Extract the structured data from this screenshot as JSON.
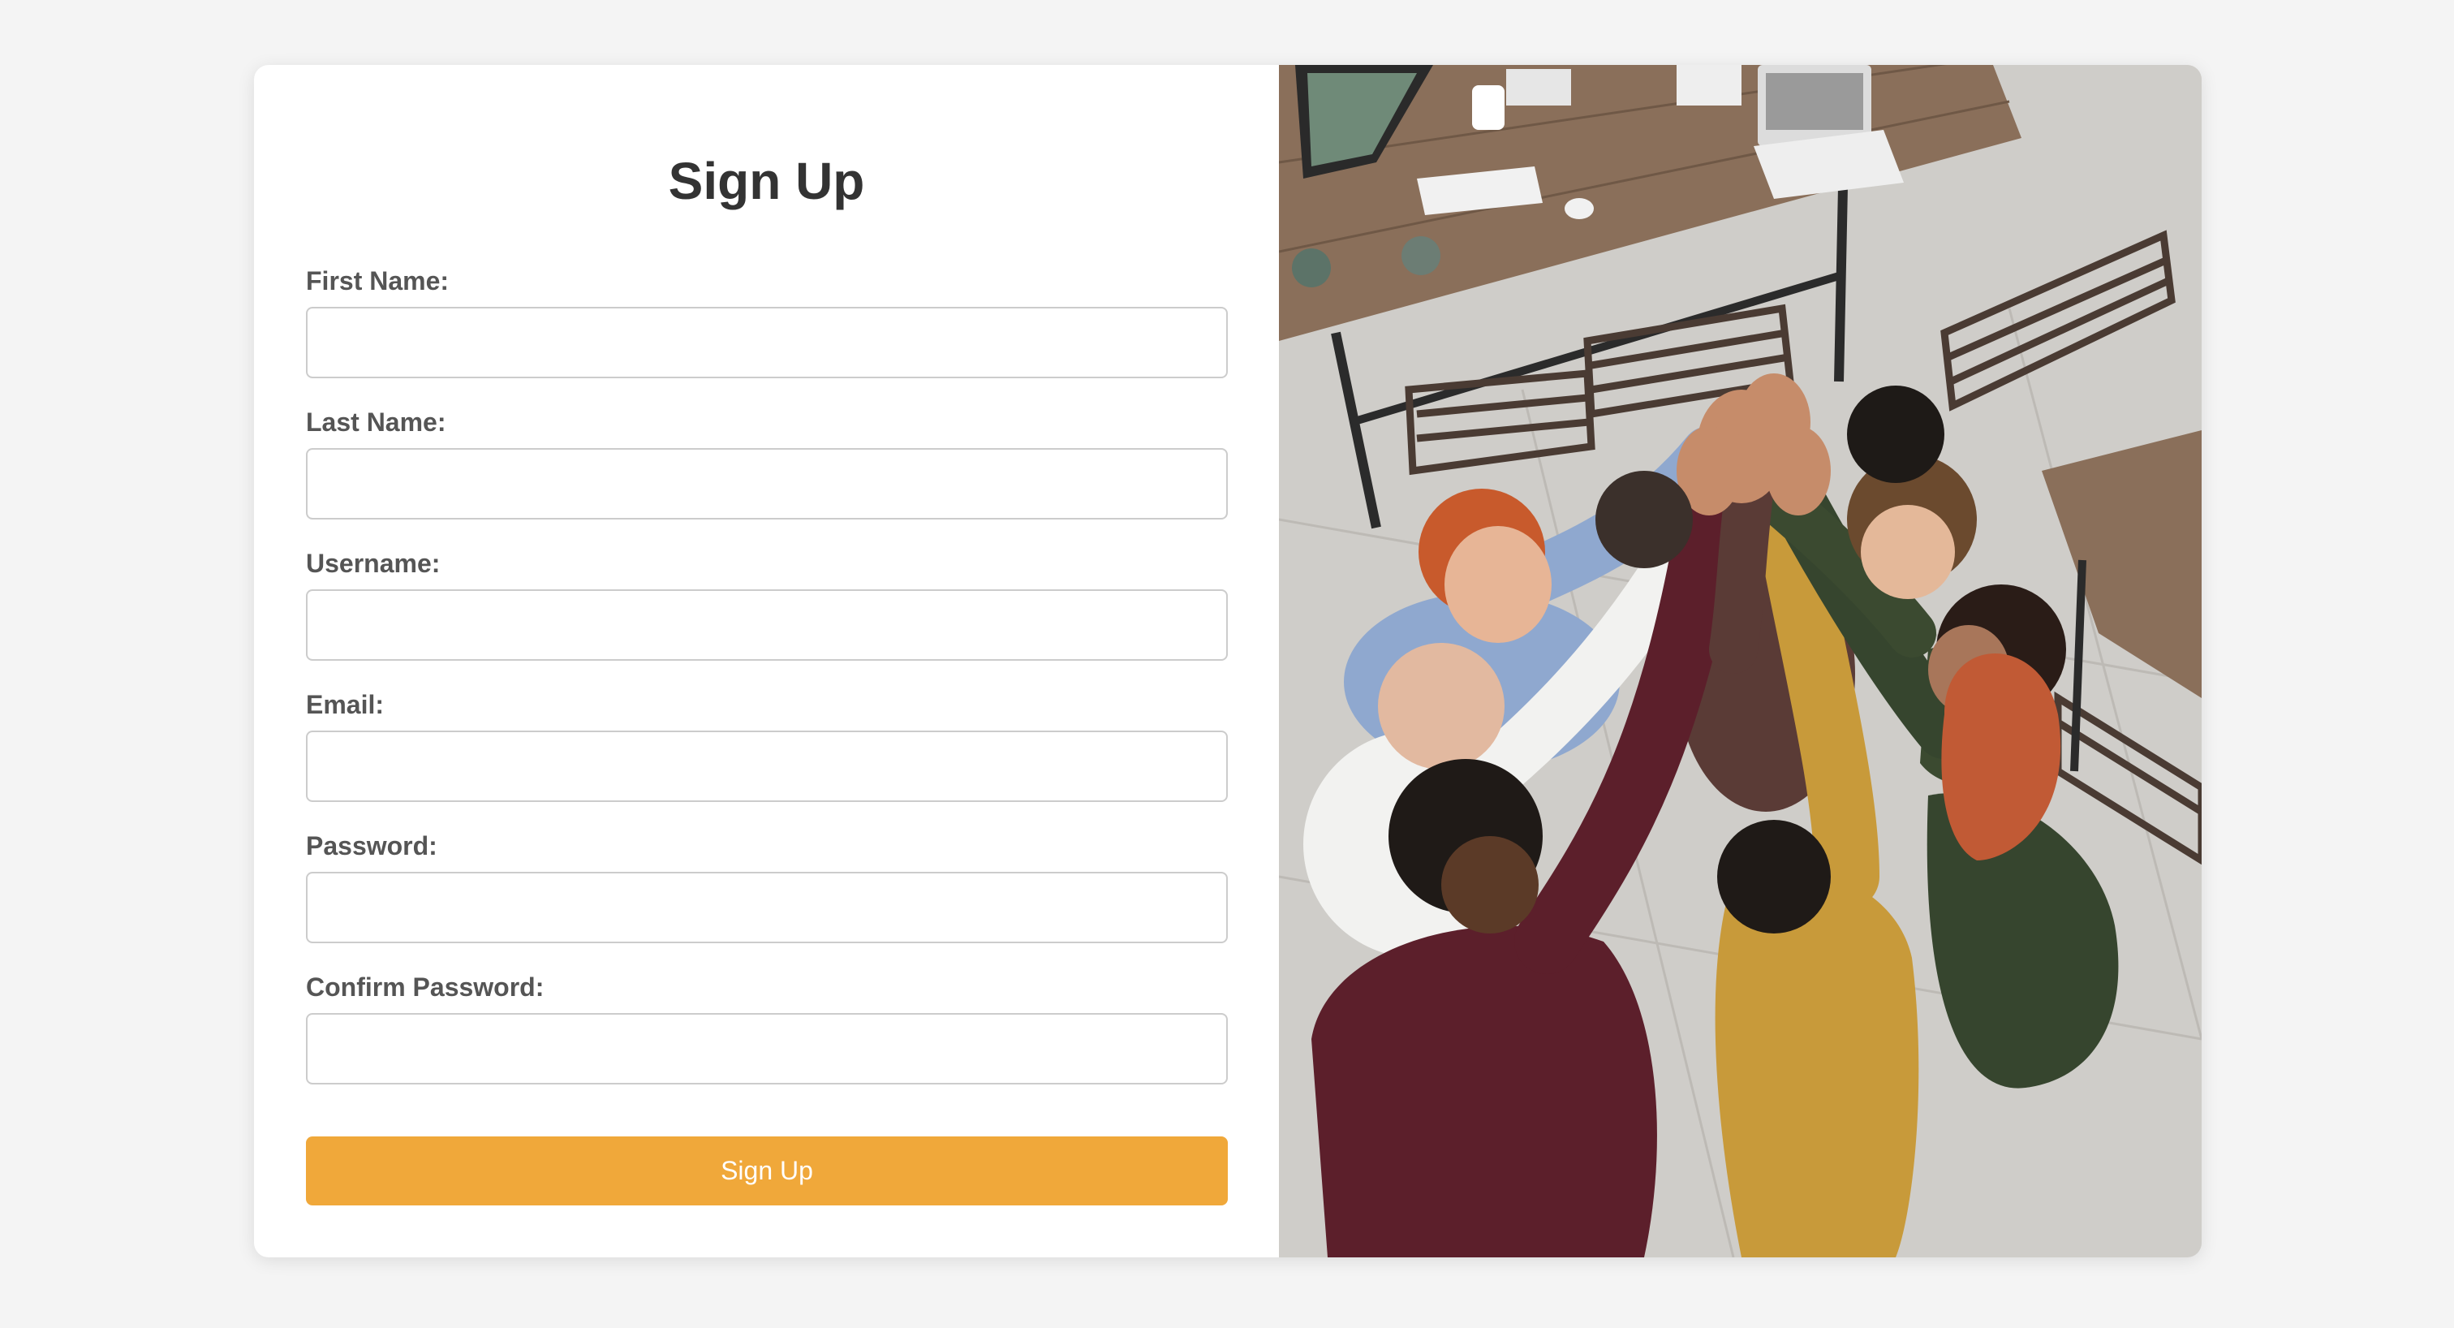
{
  "form": {
    "title": "Sign Up",
    "fields": [
      {
        "label": "First Name:",
        "value": "",
        "placeholder": ""
      },
      {
        "label": "Last Name:",
        "value": "",
        "placeholder": ""
      },
      {
        "label": "Username:",
        "value": "",
        "placeholder": ""
      },
      {
        "label": "Email:",
        "value": "",
        "placeholder": ""
      },
      {
        "label": "Password:",
        "value": "",
        "placeholder": ""
      },
      {
        "label": "Confirm Password:",
        "value": "",
        "placeholder": ""
      }
    ],
    "submit_label": "Sign Up"
  },
  "colors": {
    "page_background": "#f4f4f4",
    "card_background": "#ffffff",
    "accent": "#f0a83a",
    "title_text": "#333333",
    "label_text": "#555555"
  }
}
